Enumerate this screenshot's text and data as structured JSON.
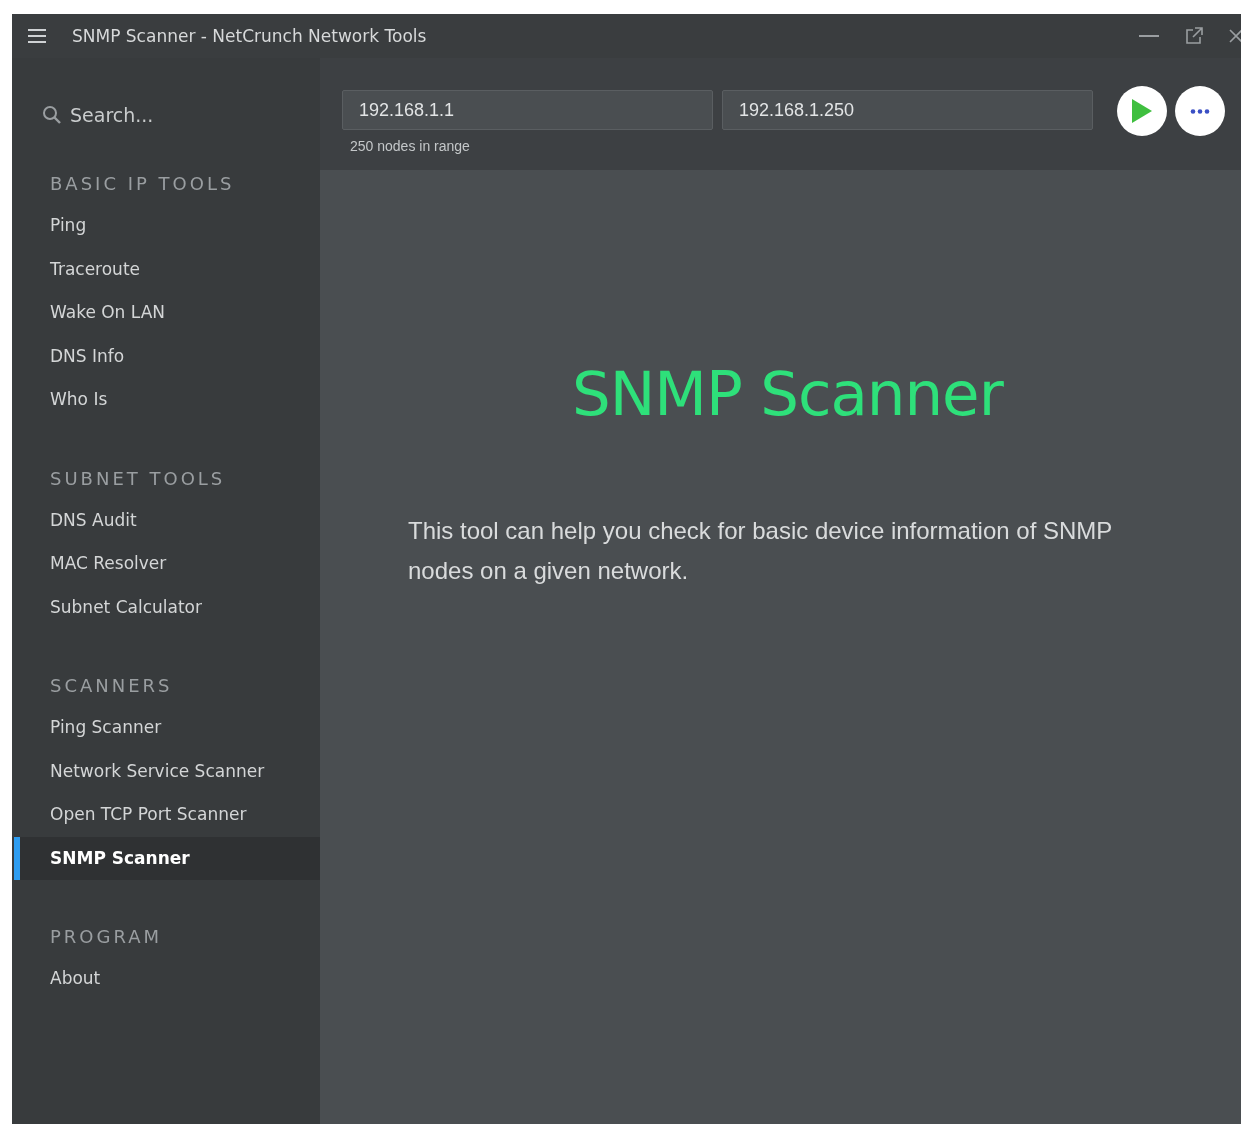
{
  "window": {
    "title": "SNMP Scanner - NetCrunch Network Tools"
  },
  "sidebar": {
    "search": {
      "placeholder": "Search..."
    },
    "sections": [
      {
        "heading": "BASIC IP TOOLS",
        "items": [
          {
            "label": "Ping",
            "selected": false
          },
          {
            "label": "Traceroute",
            "selected": false
          },
          {
            "label": "Wake On LAN",
            "selected": false
          },
          {
            "label": "DNS Info",
            "selected": false
          },
          {
            "label": "Who Is",
            "selected": false
          }
        ]
      },
      {
        "heading": "SUBNET TOOLS",
        "items": [
          {
            "label": "DNS Audit",
            "selected": false
          },
          {
            "label": "MAC Resolver",
            "selected": false
          },
          {
            "label": "Subnet Calculator",
            "selected": false
          }
        ]
      },
      {
        "heading": "SCANNERS",
        "items": [
          {
            "label": "Ping Scanner",
            "selected": false
          },
          {
            "label": "Network Service Scanner",
            "selected": false
          },
          {
            "label": "Open TCP Port Scanner",
            "selected": false
          },
          {
            "label": "SNMP Scanner",
            "selected": true
          }
        ]
      },
      {
        "heading": "PROGRAM",
        "items": [
          {
            "label": "About",
            "selected": false
          }
        ]
      }
    ]
  },
  "toolbar": {
    "range_start": "192.168.1.1",
    "range_end": "192.168.1.250",
    "range_note": "250 nodes in range"
  },
  "content": {
    "heading": "SNMP Scanner",
    "description": "This tool can help you check for basic device information of SNMP nodes on a given network."
  }
}
